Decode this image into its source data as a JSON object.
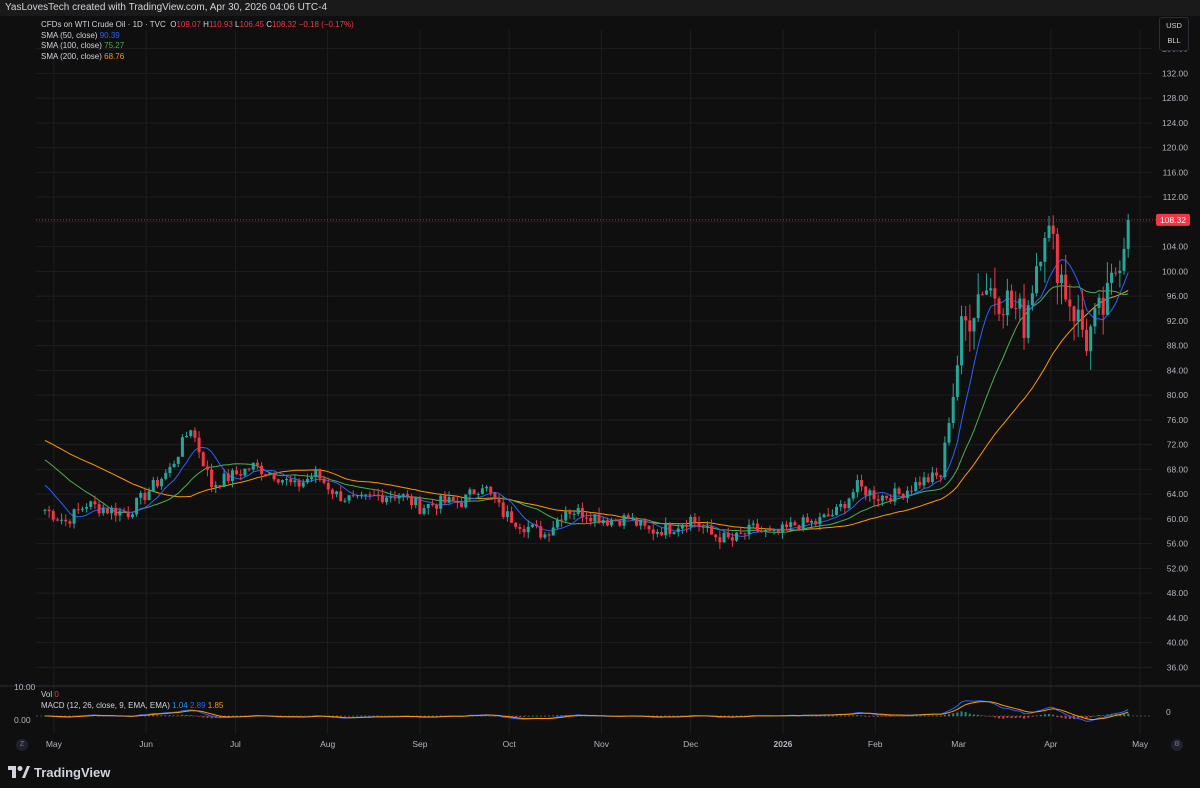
{
  "header": {
    "credit": "YasLovesTech created with TradingView.com, Apr 30, 2026 04:06 UTC-4"
  },
  "legend": {
    "symbol": "CFDs on WTI Crude Oil · 1D · TVC",
    "o_label": "O",
    "o": "109.07",
    "h_label": "H",
    "h": "110.93",
    "l_label": "L",
    "l": "106.45",
    "c_label": "C",
    "c": "108.32",
    "change": "−0.18 (−0.17%)",
    "sma50_label": "SMA (50, close)",
    "sma50": "90.39",
    "sma100_label": "SMA (100, close)",
    "sma100": "75.27",
    "sma200_label": "SMA (200, close)",
    "sma200": "68.76"
  },
  "unit": {
    "currency": "USD",
    "measure": "BLL"
  },
  "indicators": {
    "vol_label": "Vol",
    "vol": "0",
    "macd_label": "MACD (12, 26, close, 9, EMA, EMA)",
    "macd_hist": "1.04",
    "macd_line": "2.89",
    "macd_signal": "1.85",
    "vol_axis_top": "10.00",
    "vol_axis_zero": "0.00",
    "macd_axis_zero": "0"
  },
  "footer": {
    "brand": "TradingView",
    "z_button": "Z",
    "gear_button": "⚙"
  },
  "colors": {
    "up": "#26a69a",
    "down": "#f23645",
    "sma50": "#2962ff",
    "sma100": "#4caf50",
    "sma200": "#ff9800",
    "grid": "#1e1e1e"
  },
  "chart_data": {
    "type": "candlestick",
    "y_axis_ticks": [
      36,
      40,
      44,
      48,
      52,
      56,
      60,
      64,
      68,
      72,
      76,
      80,
      84,
      88,
      92,
      96,
      100,
      104,
      108,
      112,
      116,
      120,
      124,
      128,
      132,
      136
    ],
    "ylim": [
      33,
      139
    ],
    "x_axis_labels": [
      "May",
      "Jun",
      "Jul",
      "Aug",
      "Sep",
      "Oct",
      "Nov",
      "Dec",
      "2026",
      "Feb",
      "Mar",
      "Apr",
      "May"
    ],
    "x_axis_dates": [
      "2025-05-01",
      "2025-06-01",
      "2025-07-01",
      "2025-08-01",
      "2025-09-01",
      "2025-10-01",
      "2025-11-01",
      "2025-12-01",
      "2026-01-01",
      "2026-02-01",
      "2026-03-01",
      "2026-04-01",
      "2026-05-01"
    ],
    "last_price": 108.32,
    "series": [
      {
        "name": "CFDs on WTI Crude Oil",
        "points": [
          [
            "2025-04-28",
            61.5
          ],
          [
            "2025-05-05",
            59.6
          ],
          [
            "2025-05-12",
            62.4
          ],
          [
            "2025-05-19",
            61.5
          ],
          [
            "2025-05-26",
            61.0
          ],
          [
            "2025-06-02",
            64.6
          ],
          [
            "2025-06-09",
            68.0
          ],
          [
            "2025-06-16",
            74.9
          ],
          [
            "2025-06-23",
            65.5
          ],
          [
            "2025-06-30",
            67.0
          ],
          [
            "2025-07-07",
            68.5
          ],
          [
            "2025-07-14",
            67.3
          ],
          [
            "2025-07-21",
            65.2
          ],
          [
            "2025-07-28",
            67.3
          ],
          [
            "2025-08-04",
            63.9
          ],
          [
            "2025-08-11",
            62.8
          ],
          [
            "2025-08-18",
            63.7
          ],
          [
            "2025-08-25",
            64.0
          ],
          [
            "2025-09-01",
            61.9
          ],
          [
            "2025-09-08",
            62.7
          ],
          [
            "2025-09-15",
            62.7
          ],
          [
            "2025-09-22",
            65.7
          ],
          [
            "2025-09-29",
            60.9
          ],
          [
            "2025-10-06",
            58.9
          ],
          [
            "2025-10-13",
            57.5
          ],
          [
            "2025-10-20",
            61.5
          ],
          [
            "2025-10-27",
            60.9
          ],
          [
            "2025-11-03",
            59.8
          ],
          [
            "2025-11-10",
            60.1
          ],
          [
            "2025-11-17",
            58.0
          ],
          [
            "2025-11-24",
            58.5
          ],
          [
            "2025-12-01",
            60.1
          ],
          [
            "2025-12-08",
            57.4
          ],
          [
            "2025-12-15",
            56.5
          ],
          [
            "2025-12-22",
            58.4
          ],
          [
            "2025-12-29",
            57.3
          ],
          [
            "2026-01-05",
            59.1
          ],
          [
            "2026-01-12",
            59.4
          ],
          [
            "2026-01-19",
            61.1
          ],
          [
            "2026-01-26",
            65.2
          ],
          [
            "2026-02-02",
            63.6
          ],
          [
            "2026-02-09",
            64.0
          ],
          [
            "2026-02-16",
            66.0
          ],
          [
            "2026-02-23",
            67.0
          ],
          [
            "2026-03-02",
            90.0
          ],
          [
            "2026-03-09",
            98.0
          ],
          [
            "2026-03-16",
            96.0
          ],
          [
            "2026-03-23",
            92.0
          ],
          [
            "2026-03-30",
            108.0
          ],
          [
            "2026-04-06",
            97.0
          ],
          [
            "2026-04-13",
            89.0
          ],
          [
            "2026-04-20",
            95.0
          ],
          [
            "2026-04-27",
            108.32
          ]
        ]
      },
      {
        "name": "SMA (50, close)",
        "value": 90.39
      },
      {
        "name": "SMA (100, close)",
        "value": 75.27
      },
      {
        "name": "SMA (200, close)",
        "value": 68.76
      }
    ]
  }
}
